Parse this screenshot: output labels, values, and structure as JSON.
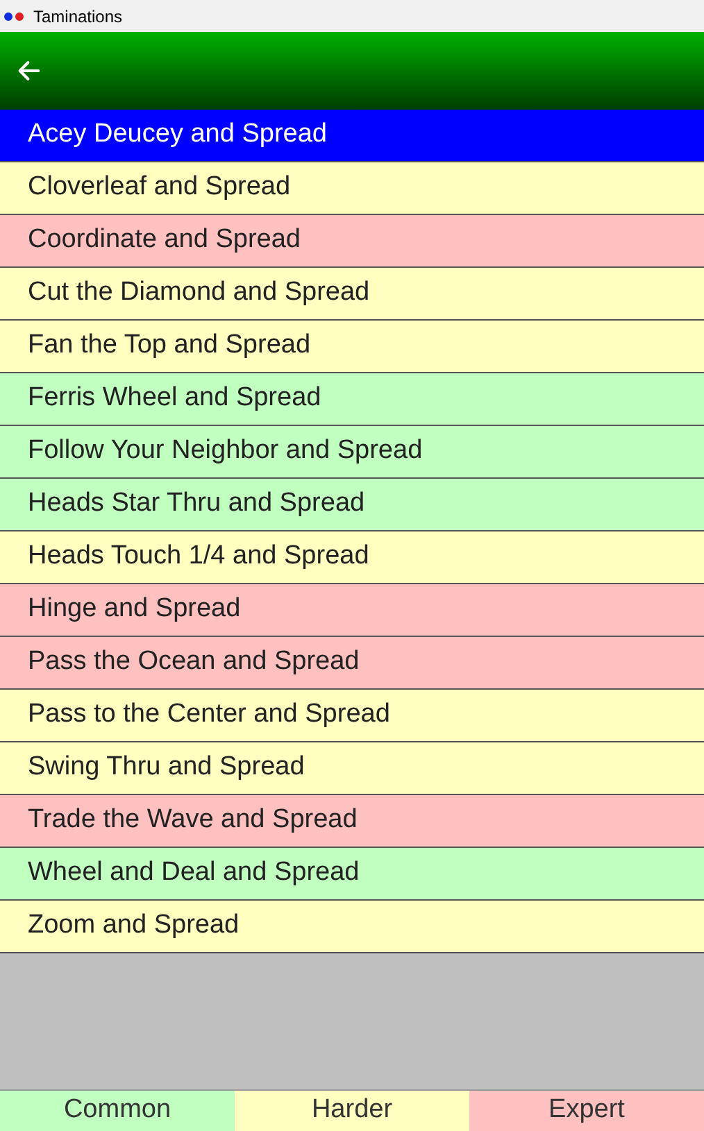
{
  "window": {
    "title": "Taminations"
  },
  "list": [
    {
      "label": "Acey Deucey and Spread",
      "selected": true
    },
    {
      "label": "Cloverleaf and Spread",
      "selected": false,
      "color": "#ffffc0"
    },
    {
      "label": "Coordinate and Spread",
      "selected": false,
      "color": "#ffc0c0"
    },
    {
      "label": "Cut the Diamond and Spread",
      "selected": false,
      "color": "#ffffc0"
    },
    {
      "label": "Fan the Top and Spread",
      "selected": false,
      "color": "#ffffc0"
    },
    {
      "label": "Ferris Wheel and Spread",
      "selected": false,
      "color": "#c0ffc0"
    },
    {
      "label": "Follow Your Neighbor and Spread",
      "selected": false,
      "color": "#c0ffc0"
    },
    {
      "label": "Heads Star Thru and Spread",
      "selected": false,
      "color": "#c0ffc0"
    },
    {
      "label": "Heads Touch 1/4 and Spread",
      "selected": false,
      "color": "#ffffc0"
    },
    {
      "label": "Hinge and Spread",
      "selected": false,
      "color": "#ffc0c0"
    },
    {
      "label": "Pass the Ocean and Spread",
      "selected": false,
      "color": "#ffc0c0"
    },
    {
      "label": "Pass to the Center and Spread",
      "selected": false,
      "color": "#ffffc0"
    },
    {
      "label": "Swing Thru and Spread",
      "selected": false,
      "color": "#ffffc0"
    },
    {
      "label": "Trade the Wave and Spread",
      "selected": false,
      "color": "#ffc0c0"
    },
    {
      "label": "Wheel and Deal and Spread",
      "selected": false,
      "color": "#c0ffc0"
    },
    {
      "label": "Zoom and Spread",
      "selected": false,
      "color": "#ffffc0"
    }
  ],
  "legend": [
    {
      "label": "Common",
      "color": "#c0ffc0"
    },
    {
      "label": "Harder",
      "color": "#ffffc0"
    },
    {
      "label": "Expert",
      "color": "#ffc0c0"
    }
  ]
}
